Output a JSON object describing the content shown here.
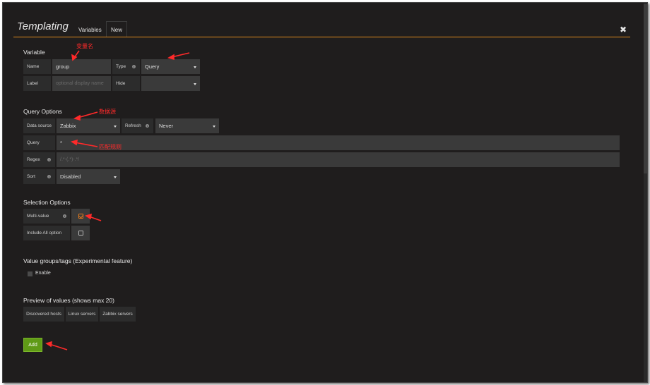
{
  "header": {
    "title": "Templating",
    "tabs": [
      {
        "label": "Variables"
      },
      {
        "label": "New"
      }
    ],
    "close_label": "✖"
  },
  "variable": {
    "section_title": "Variable",
    "name_label": "Name",
    "name_value": "group",
    "type_label": "Type",
    "type_value": "Query",
    "label_label": "Label",
    "label_placeholder": "optional display name",
    "hide_label": "Hide",
    "hide_value": ""
  },
  "query_options": {
    "section_title": "Query Options",
    "datasource_label": "Data source",
    "datasource_value": "Zabbix",
    "refresh_label": "Refresh",
    "refresh_value": "Never",
    "query_label": "Query",
    "query_value": "*",
    "regex_label": "Regex",
    "regex_placeholder": "/.*-(.*)-.*/",
    "sort_label": "Sort",
    "sort_value": "Disabled"
  },
  "selection_options": {
    "section_title": "Selection Options",
    "multi_value_label": "Multi-value",
    "multi_value_checked": true,
    "include_all_label": "Include All option",
    "include_all_checked": false
  },
  "value_groups": {
    "section_title": "Value groups/tags (Experimental feature)",
    "enable_label": "Enable"
  },
  "preview": {
    "section_title": "Preview of values (shows max 20)",
    "values": [
      "Discovered hosts",
      "Linux servers",
      "Zabbix servers"
    ]
  },
  "actions": {
    "add_label": "Add"
  },
  "annotations": {
    "variable_name": "变量名",
    "datasource": "数据源",
    "match_rule": "匹配规则"
  },
  "colors": {
    "background": "#1f1d1d",
    "accent_orange": "#e08a1e",
    "add_button_green": "#5f9a16",
    "annotation_red": "#ff2a2a"
  },
  "icons": {
    "close": "close-icon",
    "info": "info-icon",
    "dropdown": "chevron-down-icon"
  }
}
